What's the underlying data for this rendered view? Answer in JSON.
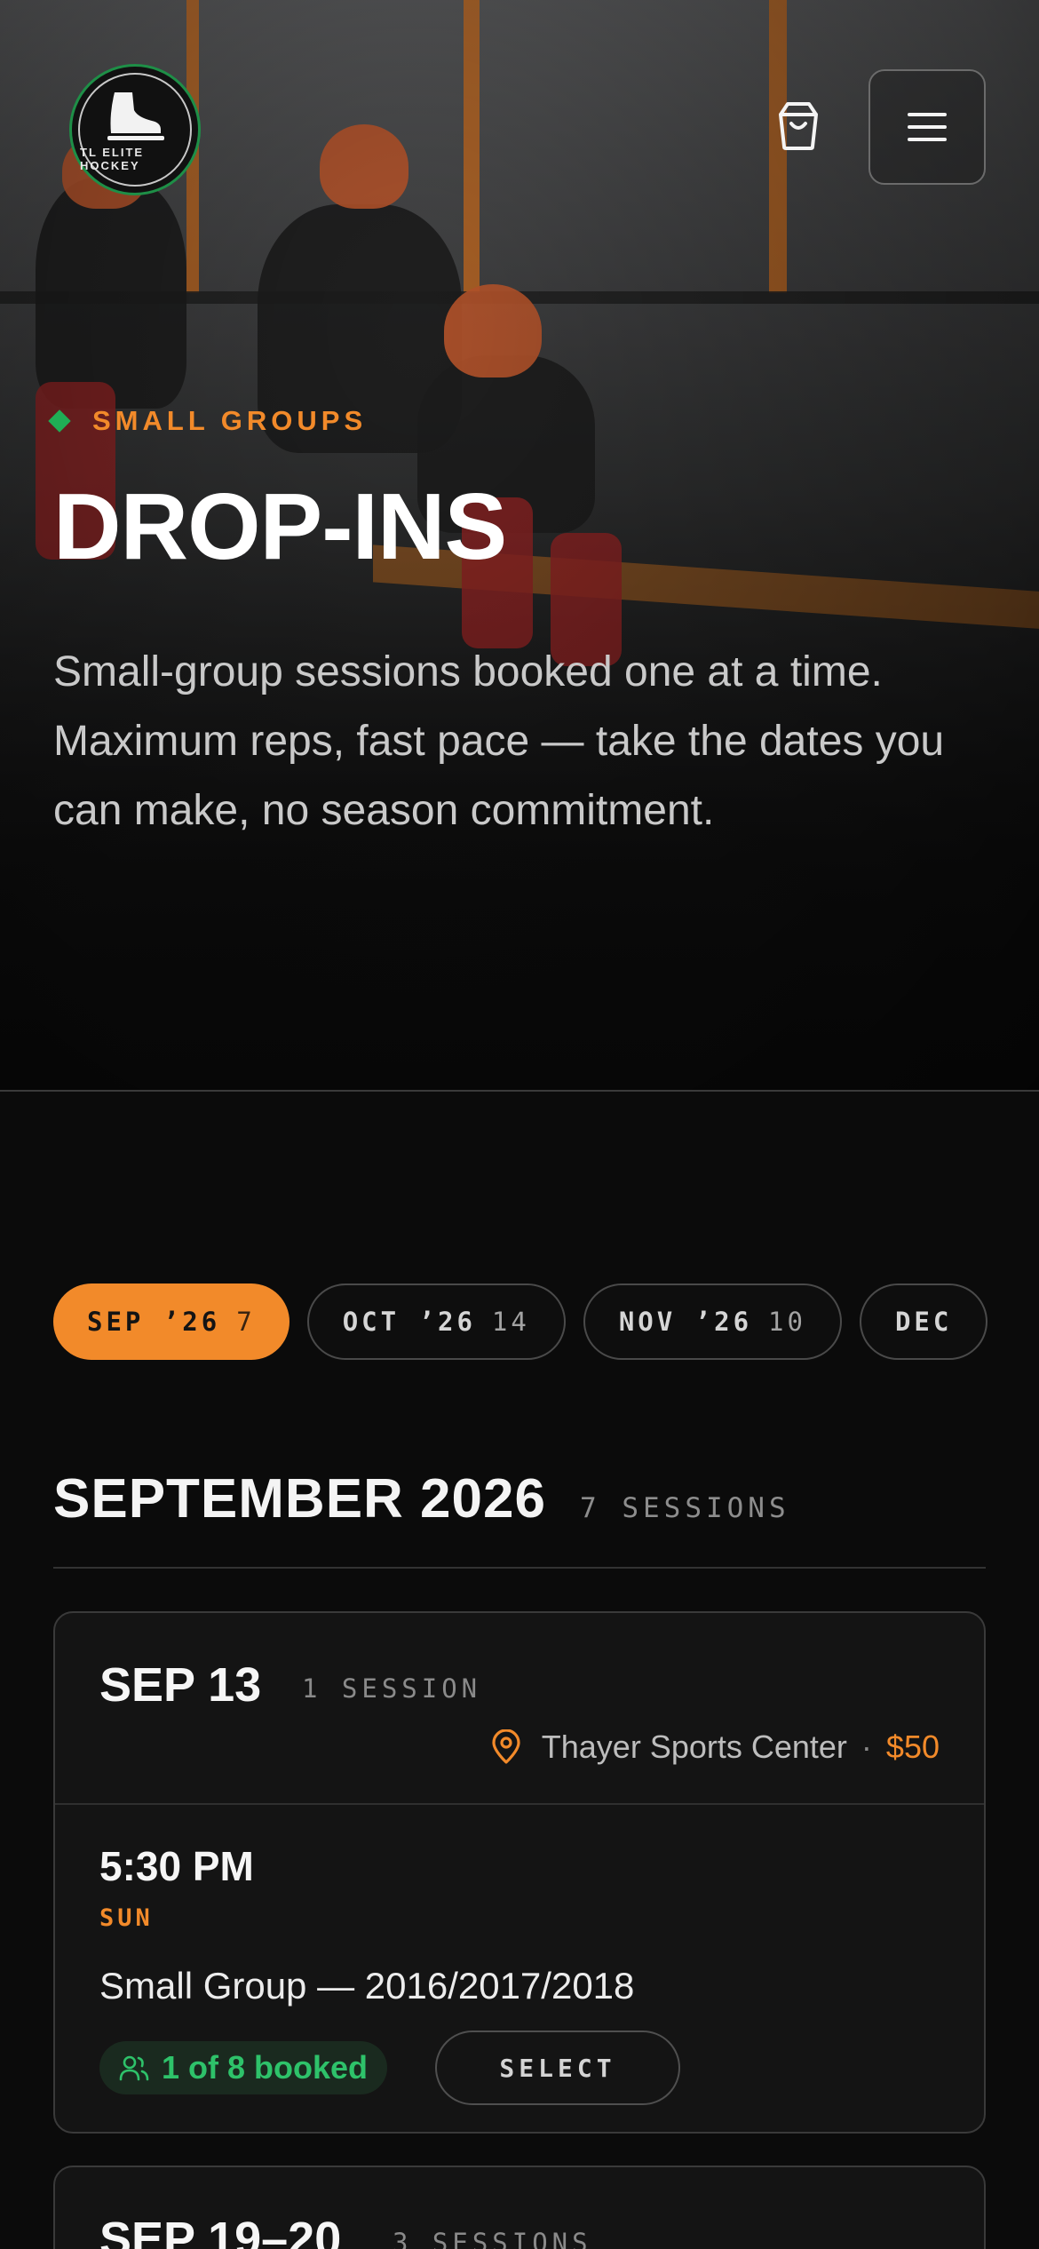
{
  "brand": {
    "logo_text": "TL ELITE HOCKEY",
    "accent": "#f28a2a",
    "green": "#1fae55"
  },
  "header": {
    "cart_icon": "shopping-bag-icon",
    "menu_icon": "hamburger-menu-icon"
  },
  "hero": {
    "eyebrow": "SMALL GROUPS",
    "title": "DROP-INS",
    "description": "Small-group sessions booked one at a time. Maximum reps, fast pace — take the dates you can make, no season commitment."
  },
  "months": [
    {
      "label": "SEP ’26",
      "count": "7",
      "active": true
    },
    {
      "label": "OCT ’26",
      "count": "14",
      "active": false
    },
    {
      "label": "NOV ’26",
      "count": "10",
      "active": false
    },
    {
      "label": "DEC",
      "count": "",
      "active": false
    }
  ],
  "month_section": {
    "title": "SEPTEMBER 2026",
    "count": "7 SESSIONS"
  },
  "days": [
    {
      "title": "SEP 13",
      "sessions_label": "1 SESSION",
      "location": "Thayer Sports Center",
      "separator": "·",
      "price": "$50",
      "sessions": [
        {
          "time": "5:30 PM",
          "dow": "SUN",
          "name": "Small Group — 2016/2017/2018",
          "booked": "1 of 8 booked",
          "select_label": "SELECT"
        }
      ]
    },
    {
      "title": "SEP 19–20",
      "sessions_label": "3 SESSIONS"
    }
  ]
}
